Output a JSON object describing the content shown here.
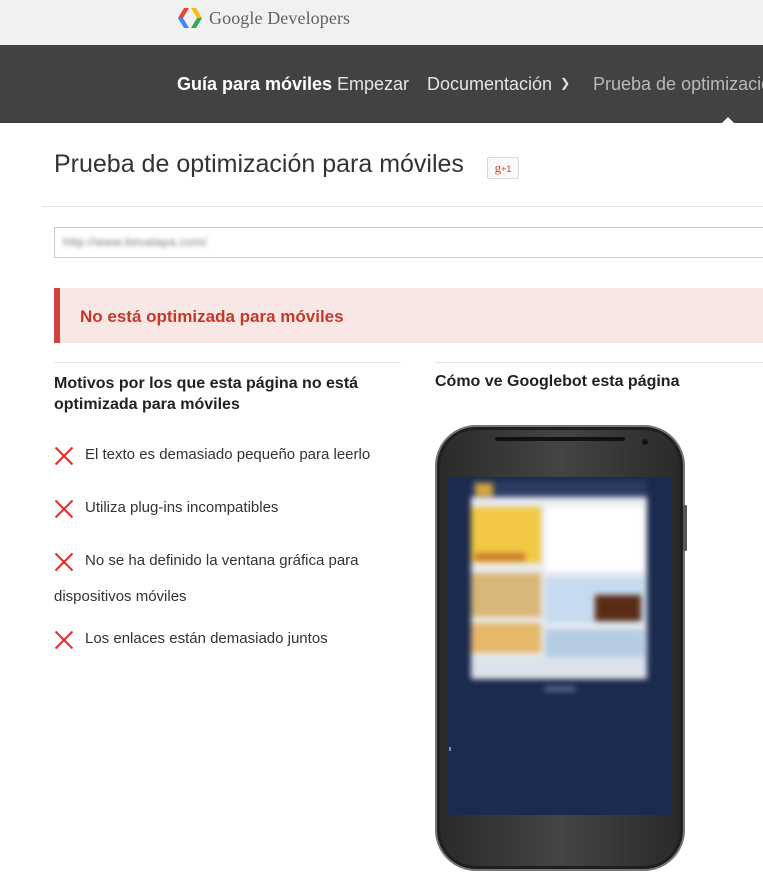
{
  "header": {
    "logo_text": "Google Developers"
  },
  "nav": {
    "items": [
      {
        "label": "Guía para móviles"
      },
      {
        "label": "Empezar"
      },
      {
        "label": "Documentación"
      },
      {
        "label": "Prueba de optimización"
      }
    ]
  },
  "page": {
    "title": "Prueba de optimización para móviles",
    "plus_one": "g+1"
  },
  "url_input": {
    "value": "http://www.bevalapa.com/"
  },
  "alert": {
    "text": "No está optimizada para móviles"
  },
  "reasons": {
    "heading": "Motivos por los que esta página no está optimizada para móviles",
    "items": [
      {
        "text": "El texto es demasiado pequeño para leerlo"
      },
      {
        "text": "Utiliza plug-ins incompatibles"
      },
      {
        "text": "No se ha definido la ventana gráfica para dispositivos móviles"
      },
      {
        "text": "Los enlaces están demasiado juntos"
      }
    ]
  },
  "preview": {
    "heading": "Cómo ve Googlebot esta página"
  },
  "colors": {
    "nav_bg": "#424242",
    "alert_bg": "#f9e7e5",
    "alert_accent": "#d0453b",
    "error_red": "#e52b24",
    "preview_bg": "#1b2a4f"
  },
  "icons": [
    "google-developers-logo-icon",
    "chevron-down-icon",
    "error-x-icon",
    "phone-frame"
  ]
}
